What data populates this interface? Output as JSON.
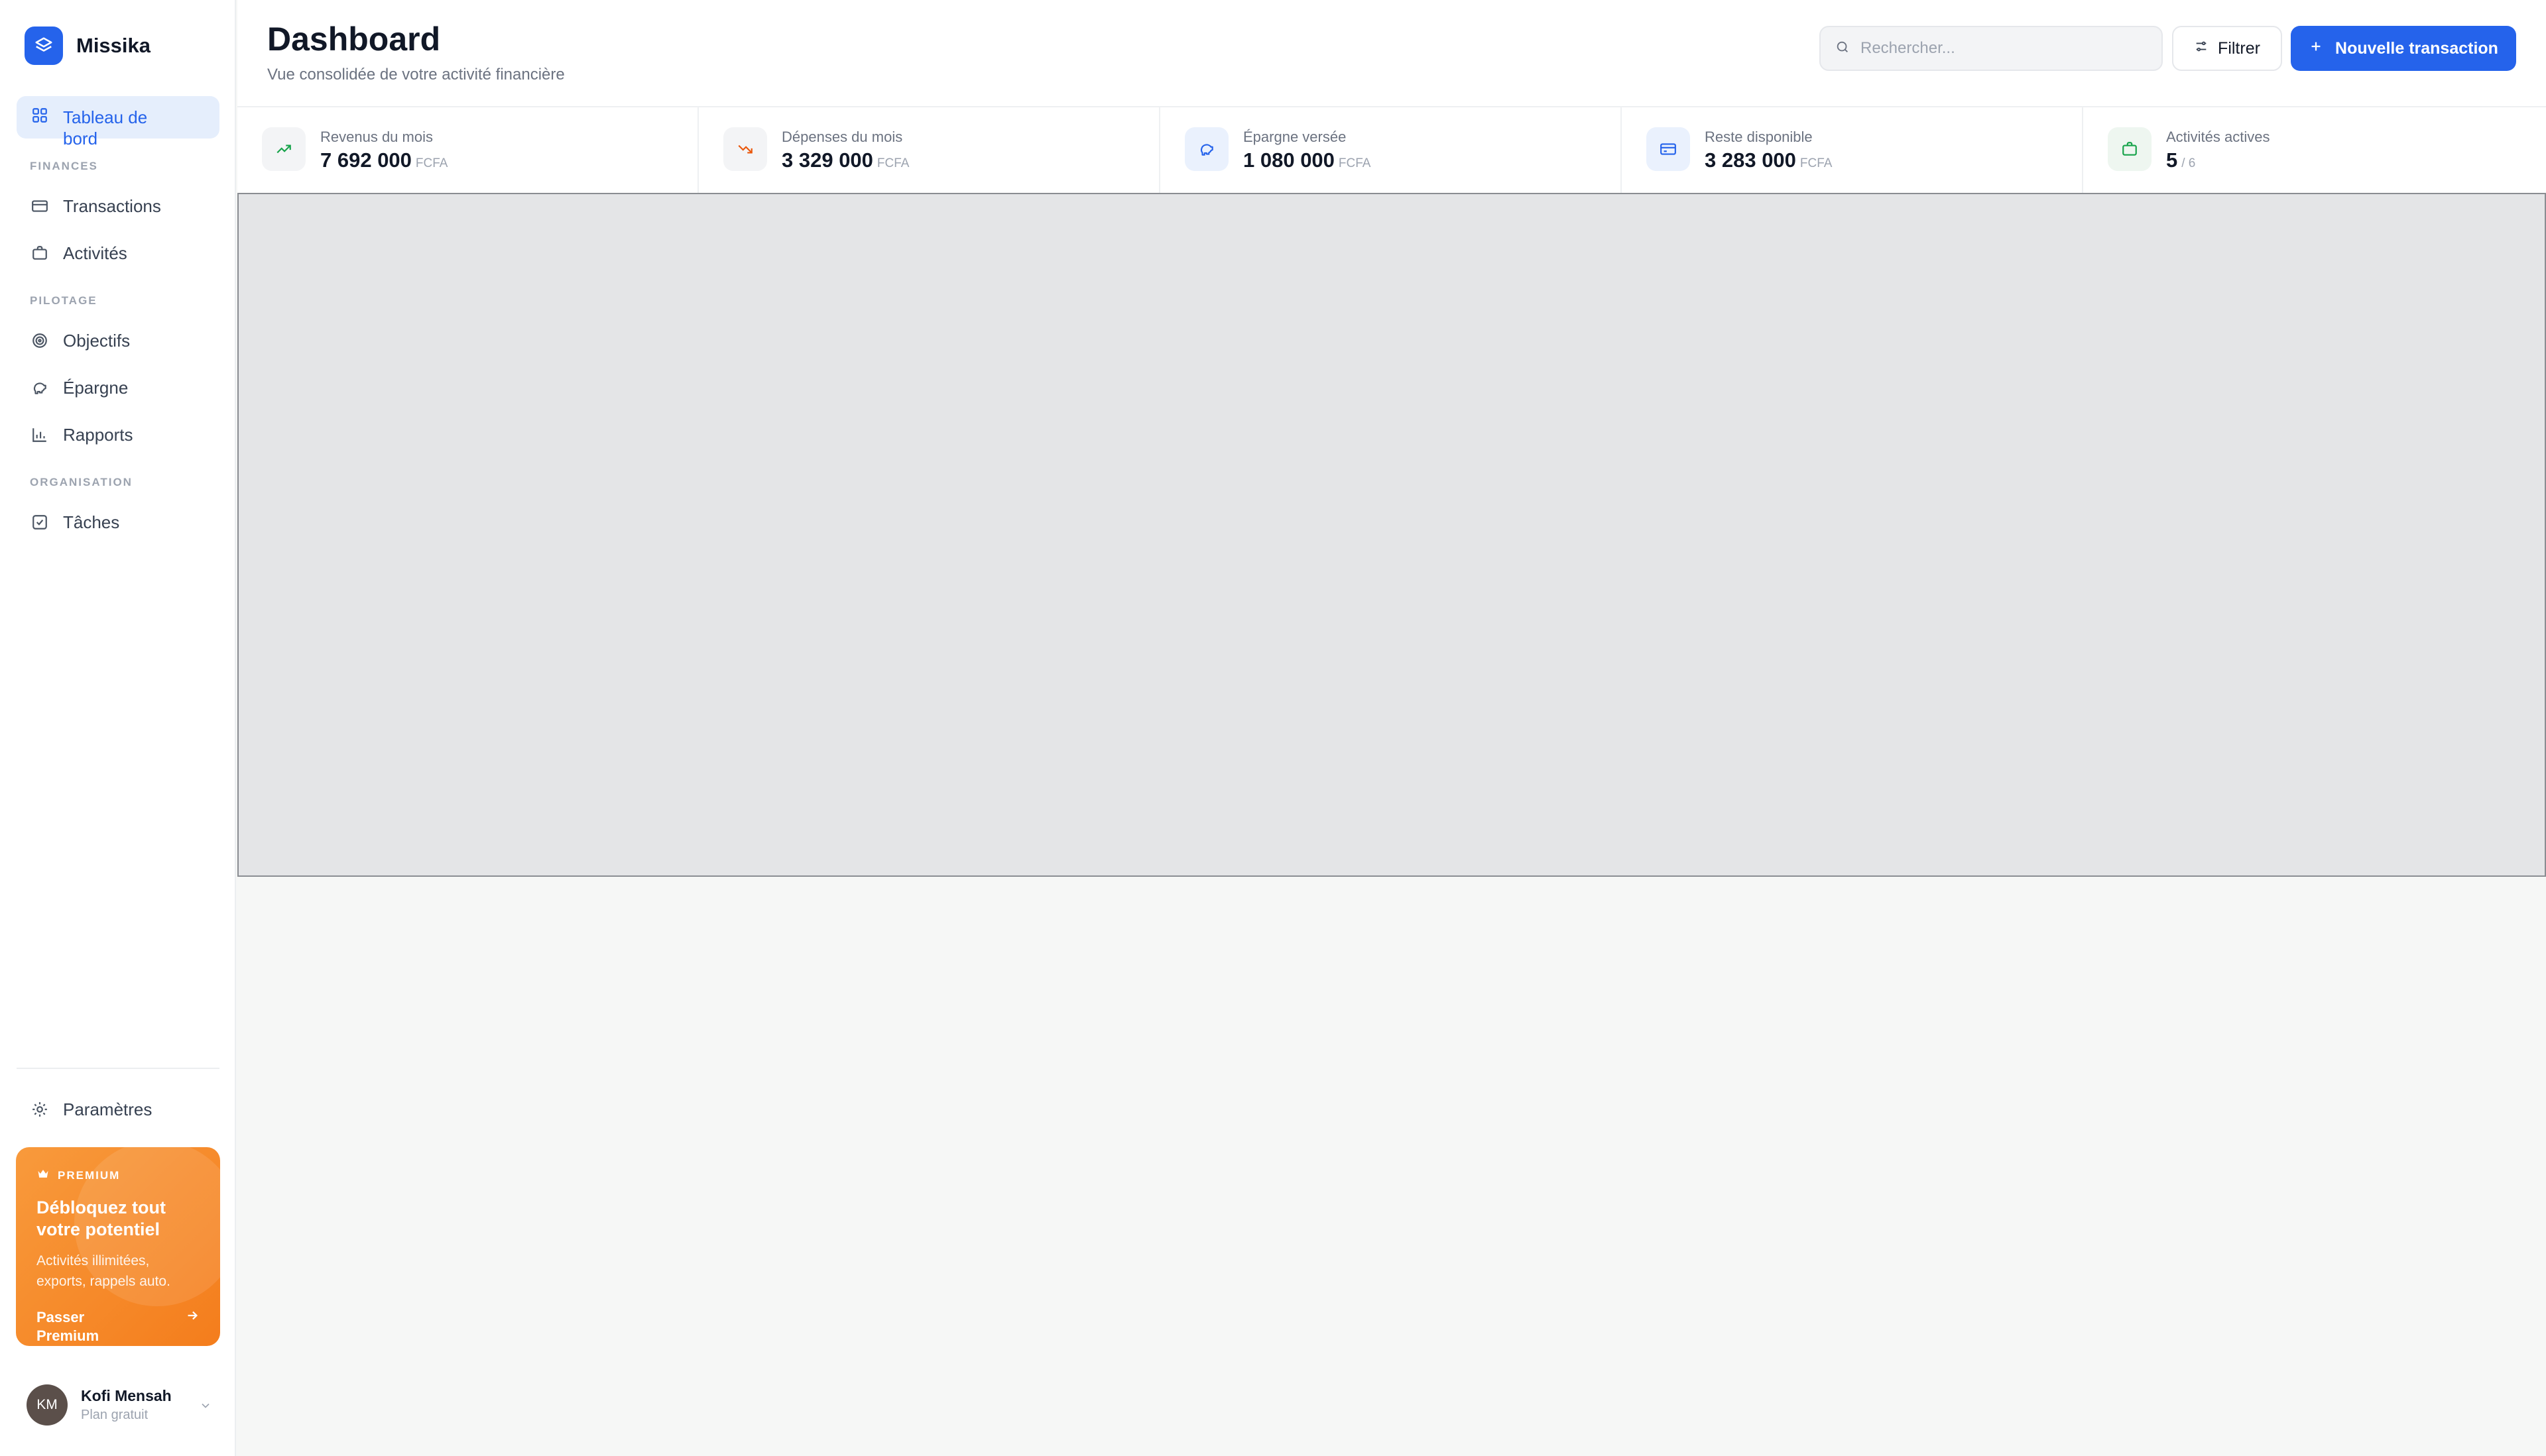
{
  "app": {
    "name": "Missika"
  },
  "sidebar": {
    "active_item": {
      "label": "Tableau de bord",
      "icon": "layout-grid-icon"
    },
    "sections": {
      "finances": "FINANCES",
      "pilotage": "PILOTAGE",
      "organisation": "ORGANISATION"
    },
    "items": {
      "transactions": {
        "label": "Transactions",
        "icon": "credit-card-icon"
      },
      "activites": {
        "label": "Activités",
        "icon": "briefcase-icon"
      },
      "objectifs": {
        "label": "Objectifs",
        "icon": "target-icon"
      },
      "epargne": {
        "label": "Épargne",
        "icon": "piggy-bank-icon"
      },
      "rapports": {
        "label": "Rapports",
        "icon": "bar-chart-icon"
      },
      "taches": {
        "label": "Tâches",
        "icon": "check-square-icon"
      },
      "parametres": {
        "label": "Paramètres",
        "icon": "settings-icon"
      }
    },
    "premium": {
      "tag": "PREMIUM",
      "title": "Débloquez tout votre potentiel",
      "description": "Activités illimitées, exports, rappels auto.",
      "cta": "Passer Premium"
    },
    "user": {
      "initials": "KM",
      "name": "Kofi Mensah",
      "plan": "Plan gratuit"
    }
  },
  "header": {
    "title": "Dashboard",
    "subtitle": "Vue consolidée de votre activité financière",
    "search_placeholder": "Rechercher...",
    "filter_label": "Filtrer",
    "new_transaction_label": "Nouvelle transaction"
  },
  "stats": [
    {
      "label": "Revenus du mois",
      "value": "7 692 000",
      "unit": "FCFA",
      "icon": "trending-up-icon",
      "color": "#16a34a"
    },
    {
      "label": "Dépenses du mois",
      "value": "3 329 000",
      "unit": "FCFA",
      "icon": "trending-down-icon",
      "color": "#ea580c"
    },
    {
      "label": "Épargne versée",
      "value": "1 080 000",
      "unit": "FCFA",
      "icon": "piggy-bank-icon",
      "color": "#2563eb"
    },
    {
      "label": "Reste disponible",
      "value": "3 283 000",
      "unit": "FCFA",
      "icon": "wallet-card-icon",
      "color": "#2563eb"
    },
    {
      "label": "Activités actives",
      "value": "5",
      "unit": "/ 6",
      "icon": "briefcase-icon",
      "color": "#16a34a"
    }
  ],
  "colors": {
    "accent": "#2563eb",
    "premium_from": "#f89a3c",
    "premium_to": "#f47d1c"
  }
}
